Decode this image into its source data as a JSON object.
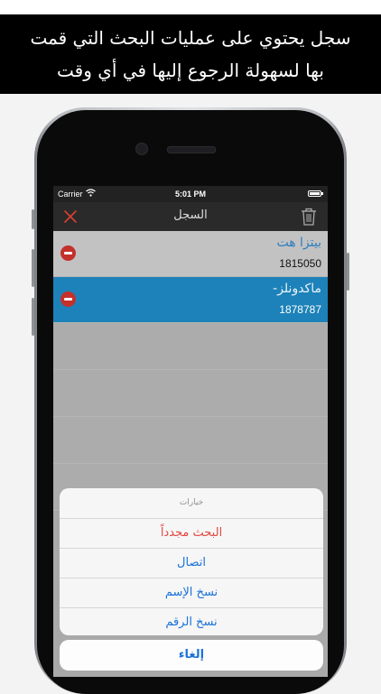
{
  "banner": {
    "line1": "سجل يحتوي على عمليات البحث التي قمت",
    "line2": "بها لسهولة الرجوع إليها في أي وقت"
  },
  "statusbar": {
    "carrier": "Carrier",
    "time": "5:01 PM"
  },
  "navbar": {
    "title": "السجل",
    "left_icon": "close-icon",
    "right_icon": "trash-icon",
    "close_color": "#d9412f"
  },
  "history": [
    {
      "name": "بيتزا هت",
      "number": "1815050"
    },
    {
      "name": "ماكدونلز-",
      "number": "1878787"
    }
  ],
  "action_sheet": {
    "title": "خيارات",
    "items": [
      {
        "label": "البحث مجدداً",
        "style": "destructive"
      },
      {
        "label": "اتصال",
        "style": "default"
      },
      {
        "label": "نسخ الإسم",
        "style": "default"
      },
      {
        "label": "نسخ الرقم",
        "style": "default"
      }
    ],
    "cancel": "إلغاء",
    "accent": "#1a73d9",
    "destructive_color": "#e2463f"
  }
}
